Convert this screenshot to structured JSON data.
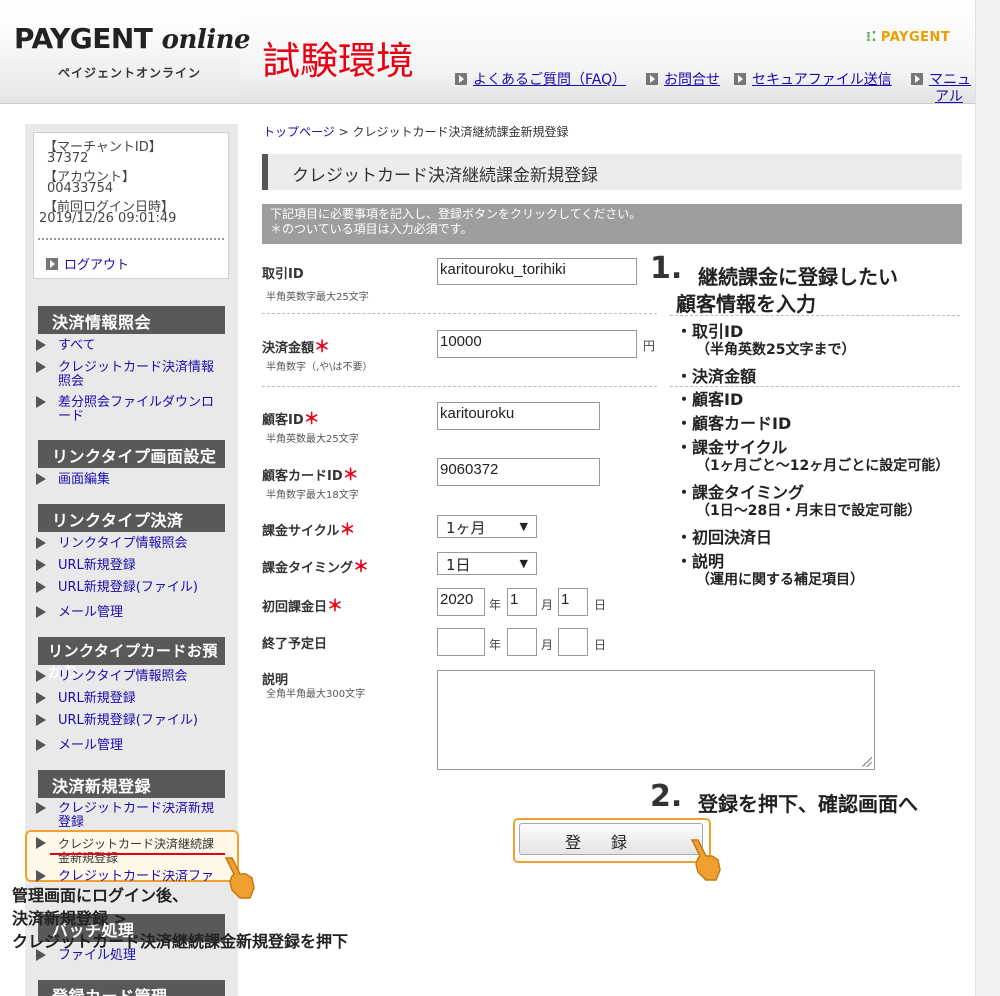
{
  "header": {
    "logo_main": "PAYGENT",
    "logo_online": "online",
    "logo_sub": "ペイジェントオンライン",
    "env_title": "試験環境",
    "brand": "PAYGENT",
    "nav": [
      "よくあるご質問（FAQ）",
      "お問合せ",
      "セキュアファイル送信",
      "マニュ",
      "アル"
    ]
  },
  "account": {
    "merchant_label": "【マーチャントID】",
    "merchant_id": "37372",
    "account_label": "【アカウント】",
    "account_id": "00433754",
    "last_login_label": "【前回ログイン日時】",
    "last_login": "2019/12/26 09:01:49",
    "logout": "ログアウト"
  },
  "sidebar": {
    "sections": [
      {
        "title": "決済情報照会"
      },
      {
        "title": "リンクタイプ画面設定"
      },
      {
        "title": "リンクタイプ決済"
      },
      {
        "title": "リンクタイプカードお預かり"
      },
      {
        "title": "決済新規登録"
      },
      {
        "title": "バッチ処理"
      },
      {
        "title": "登録カード管理"
      }
    ],
    "items": {
      "all": "すべて",
      "cc_inquiry": "クレジットカード決済情報照会",
      "diff_download": "差分照会ファイルダウンロード",
      "screen_edit": "画面編集",
      "lt_inquiry": "リンクタイプ情報照会",
      "url_new": "URL新規登録",
      "url_new_file": "URL新規登録(ファイル)",
      "mail_mgmt": "メール管理",
      "ltc_inquiry": "リンクタイプ情報照会",
      "ltc_url_new": "URL新規登録",
      "ltc_url_new_file": "URL新規登録(ファイル)",
      "ltc_mail_mgmt": "メール管理",
      "cc_new": "クレジットカード決済新規登録",
      "cc_recurring_new": "クレジットカード決済継続課金新規登録",
      "cc_partial": "クレジットカード決済ファイル",
      "file_process": "ファイル処理"
    }
  },
  "main": {
    "breadcrumb_top": "トップページ",
    "breadcrumb_sep": " > ",
    "breadcrumb_current": "クレジットカード決済継続課金新規登録",
    "title": "クレジットカード決済継続課金新規登録",
    "notice_line1": "下記項目に必要事項を記入し、登録ボタンをクリックしてください。",
    "notice_line2": "＊のついている項目は入力必須です。",
    "required_mark": "＊",
    "form": {
      "trading_id": {
        "label": "取引ID",
        "hint": "半角英数字最大25文字",
        "value": "karitouroku_torihiki"
      },
      "amount": {
        "label": "決済金額",
        "hint": "半角数字（,や\\は不要）",
        "value": "10000",
        "unit": "円"
      },
      "customer_id": {
        "label": "顧客ID",
        "hint": "半角英数最大25文字",
        "value": "karitouroku"
      },
      "card_id": {
        "label": "顧客カードID",
        "hint": "半角数字最大18文字",
        "value": "9060372"
      },
      "cycle": {
        "label": "課金サイクル",
        "value": "1ヶ月"
      },
      "timing": {
        "label": "課金タイミング",
        "value": "1日"
      },
      "first_date": {
        "label": "初回課金日",
        "year": "2020",
        "month": "1",
        "day": "1"
      },
      "end_date": {
        "label": "終了予定日",
        "year": "",
        "month": "",
        "day": ""
      },
      "date_units": {
        "year": "年",
        "month": "月",
        "day": "日"
      },
      "description": {
        "label": "説明",
        "hint": "全角半角最大300文字",
        "value": ""
      }
    },
    "submit": "登録"
  },
  "annotations": {
    "step1_num": "1.",
    "step1_line1": "継続課金に登録したい",
    "step1_line2": "顧客情報を入力",
    "items": [
      "・取引ID",
      "（半角英数25文字まで）",
      "・決済金額",
      "・顧客ID",
      "・顧客カードID",
      "・課金サイクル",
      "（1ヶ月ごと～12ヶ月ごとに設定可能）",
      "・課金タイミング",
      "（1日～28日・月末日で設定可能）",
      "・初回決済日",
      "・説明",
      "（運用に関する補足項目）"
    ],
    "step2_num": "2.",
    "step2_text": "登録を押下、確認画面へ",
    "login_line1": "管理画面にログイン後、",
    "login_line2": "決済新規登録 >",
    "login_line3": "クレジットカード決済継続課金新規登録を押下"
  },
  "colors": {
    "accent_red": "#e60012",
    "highlight_orange": "#f0a030",
    "sidebar_head": "#595959"
  }
}
